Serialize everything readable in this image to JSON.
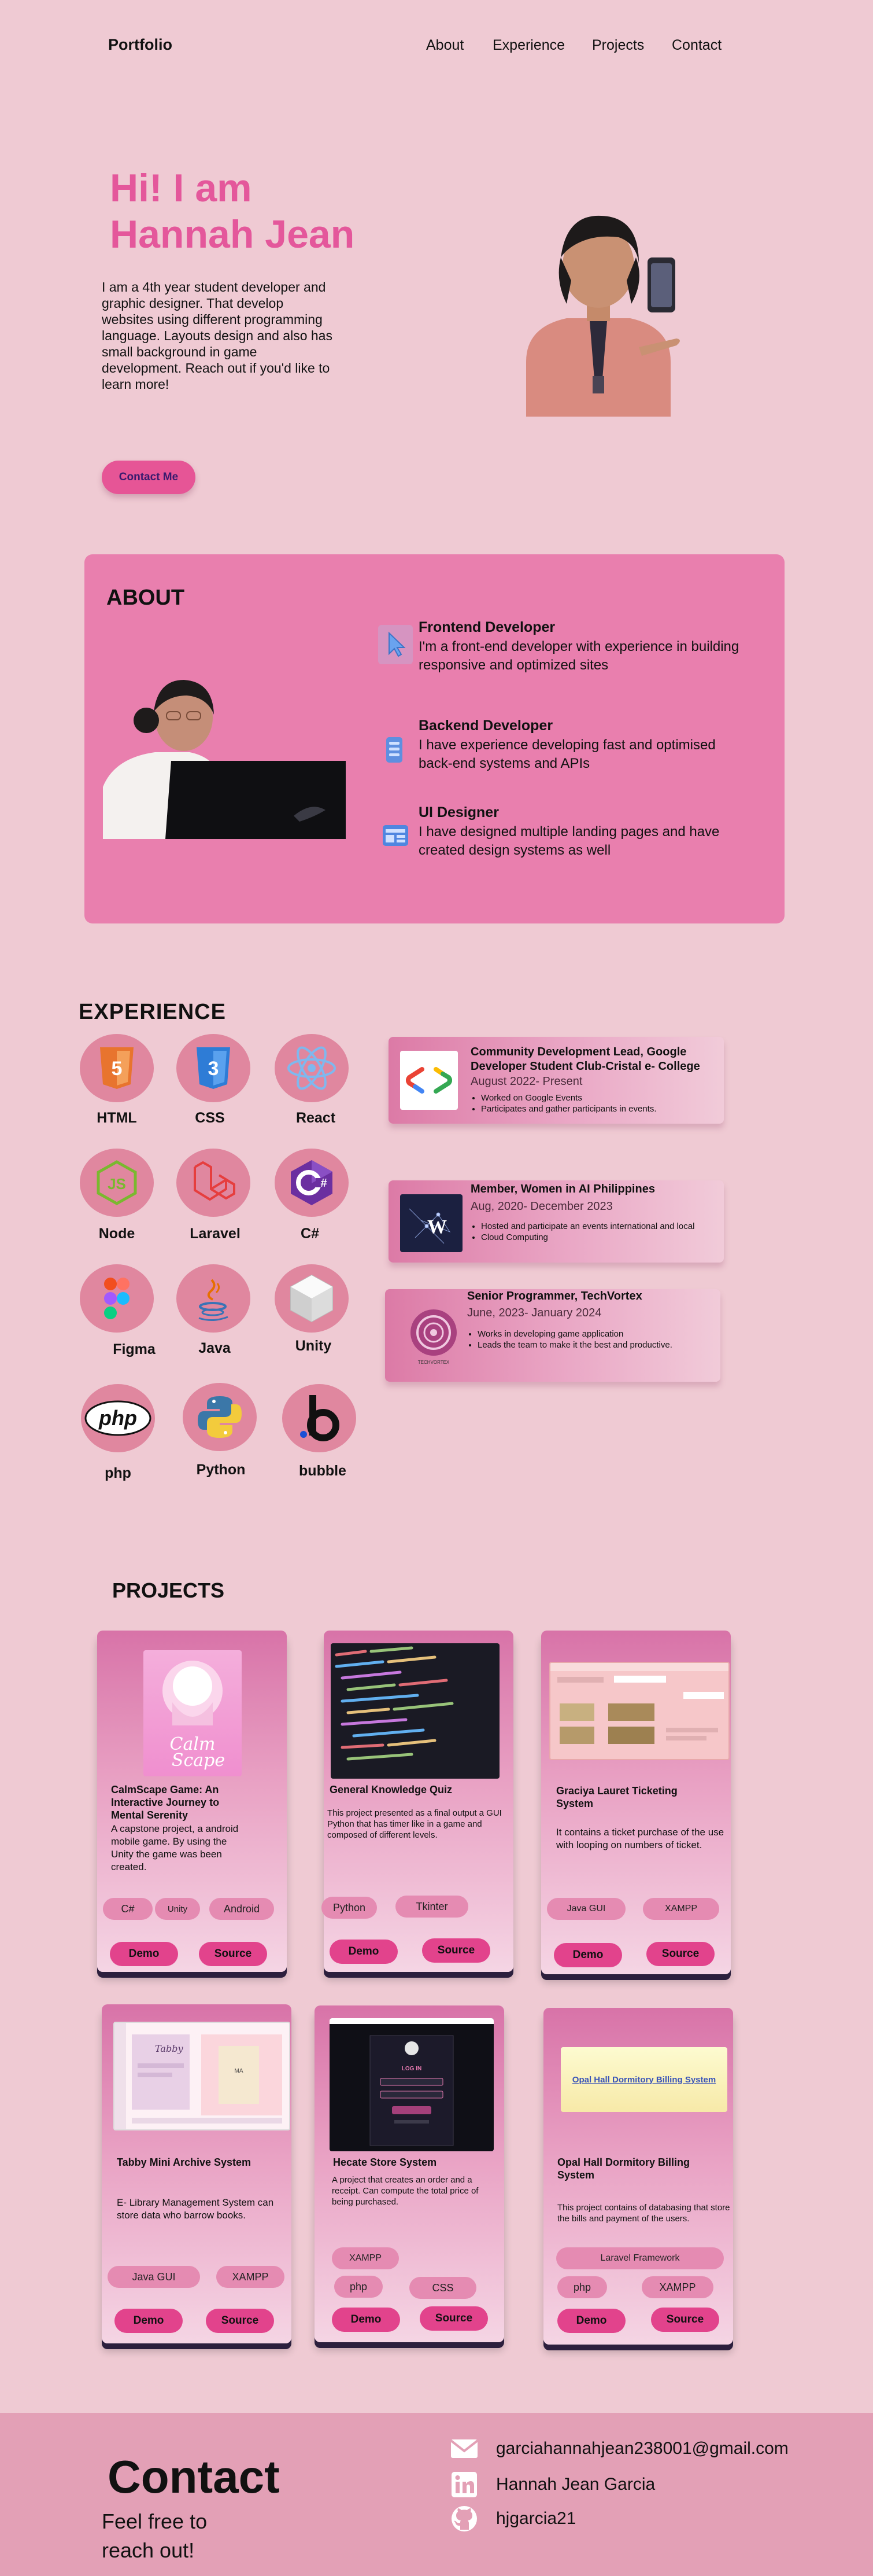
{
  "nav": {
    "brand": "Portfolio",
    "links": [
      "About",
      "Experience",
      "Projects",
      "Contact"
    ]
  },
  "hero": {
    "title_line1": "Hi! I am",
    "title_line2": "Hannah Jean",
    "text": "I am a 4th year student developer and graphic designer. That develop websites using different programming language. Layouts design and also has small background in game development. Reach out if you'd like to learn more!",
    "cta": "Contact Me"
  },
  "about": {
    "heading": "ABOUT",
    "skills": [
      {
        "title": "Frontend Developer",
        "desc": "I'm a front-end developer with experience in building responsive and optimized sites",
        "icon": "cursor-icon"
      },
      {
        "title": "Backend Developer",
        "desc": "I have experience developing fast and optimised back-end systems and APIs",
        "icon": "server-icon"
      },
      {
        "title": "UI Designer",
        "desc": "I have designed multiple landing pages and have created design systems as well",
        "icon": "layout-icon"
      }
    ]
  },
  "experience": {
    "heading": "EXPERIENCE",
    "tech": [
      "HTML",
      "CSS",
      "React",
      "Node",
      "Laravel",
      "C#",
      "Figma",
      "Java",
      "Unity",
      "php",
      "Python",
      "bubble"
    ],
    "jobs": [
      {
        "title": "Community Development Lead, Google Developer Student Club-Cristal e- College",
        "date": "August 2022- Present",
        "bullets": [
          "Worked on Google Events",
          "Participates and gather participants in events."
        ]
      },
      {
        "title": "Member, Women in AI Philippines",
        "date": "Aug, 2020- December 2023",
        "bullets": [
          "Hosted and participate an events international and local",
          "Cloud Computing"
        ]
      },
      {
        "title": "Senior Programmer, TechVortex",
        "date": "June, 2023- January 2024",
        "bullets": [
          "Works in developing game application",
          "Leads the team to make it the best and productive."
        ]
      }
    ]
  },
  "projects": {
    "heading": "PROJECTS",
    "demo_label": "Demo",
    "source_label": "Source",
    "items": [
      {
        "title": "CalmScape Game: An Interactive Journey to Mental Serenity",
        "desc": "A capstone project, a android mobile game. By using the Unity the game was been created.",
        "tags": [
          "C#",
          "Unity",
          "Android"
        ],
        "image_text": "Calm Scape"
      },
      {
        "title": "General Knowledge Quiz",
        "desc": "This project presented as a final output a GUI Python that has timer like in a game and composed of different levels.",
        "tags": [
          "Python",
          "Tkinter"
        ]
      },
      {
        "title": "Graciya Lauret Ticketing System",
        "desc": "It contains a ticket purchase of the use with looping on numbers of ticket.",
        "tags": [
          "Java GUI",
          "XAMPP"
        ]
      },
      {
        "title": "Tabby Mini Archive System",
        "desc": "E- Library Management System can store data who barrow books.",
        "tags": [
          "Java GUI",
          "XAMPP"
        ],
        "image_text": "Tabby"
      },
      {
        "title": "Hecate Store System",
        "desc": "A project that creates an order and a receipt. Can compute the total price of being purchased.",
        "tags": [
          "XAMPP",
          "php",
          "CSS"
        ],
        "image_text": "LOG IN"
      },
      {
        "title": "Opal Hall Dormitory Billing System",
        "desc": "This project contains of databasing that store the bills and payment of the users.",
        "tags": [
          "Laravel Framework",
          "php",
          "XAMPP"
        ],
        "image_text": "Opal Hall Dormitory Billing System"
      }
    ]
  },
  "contact": {
    "title": "Contact",
    "sub_line1": "Feel free to",
    "sub_line2": "reach out!",
    "email": "garciahannahjean238001@gmail.com",
    "linkedin": "Hannah Jean Garcia",
    "github": "hjgarcia21"
  },
  "colors": {
    "background": "#efcad3",
    "accent": "#e4579b",
    "card": "#e97fae"
  }
}
